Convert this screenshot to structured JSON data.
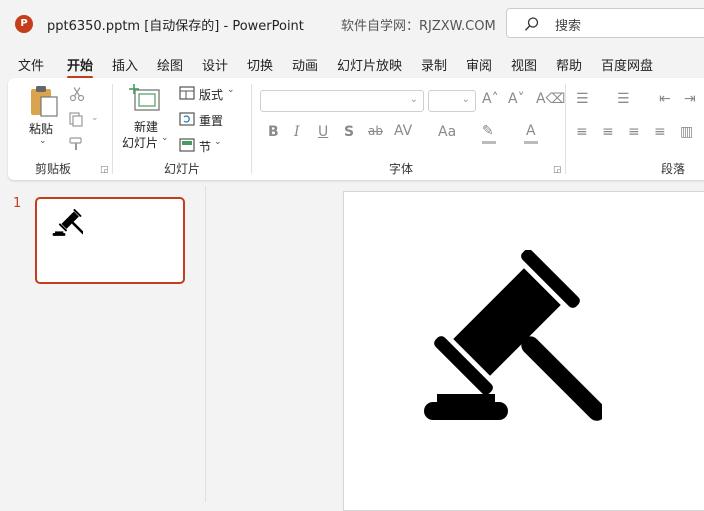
{
  "titlebar": {
    "app_logo": "P",
    "doc_title": "ppt6350.pptm [自动保存的]  -  PowerPoint",
    "watermark": "软件自学网：RJZXW.COM",
    "search_placeholder": "搜索"
  },
  "tabs": [
    "文件",
    "开始",
    "插入",
    "绘图",
    "设计",
    "切换",
    "动画",
    "幻灯片放映",
    "录制",
    "审阅",
    "视图",
    "帮助",
    "百度网盘"
  ],
  "active_tab": "开始",
  "ribbon": {
    "clipboard": {
      "paste": "粘贴",
      "group": "剪贴板"
    },
    "slides": {
      "new_slide_1": "新建",
      "new_slide_2": "幻灯片",
      "layout": "版式",
      "reset": "重置",
      "section": "节",
      "group": "幻灯片"
    },
    "font": {
      "group": "字体",
      "bold": "B",
      "italic": "I",
      "underline": "U",
      "shadow": "S",
      "strike": "ab",
      "spacing": "AV",
      "case": "Aa"
    },
    "paragraph": {
      "group": "段落"
    }
  },
  "slides_pane": {
    "slide_number": "1"
  },
  "colors": {
    "accent": "#c43e1c",
    "background": "#f3f3f3"
  },
  "icons": [
    "powerpoint-logo-icon",
    "search-icon",
    "paste-icon",
    "cut-icon",
    "copy-icon",
    "format-painter-icon",
    "new-slide-icon",
    "layout-icon",
    "reset-icon",
    "section-icon",
    "gavel-icon"
  ]
}
